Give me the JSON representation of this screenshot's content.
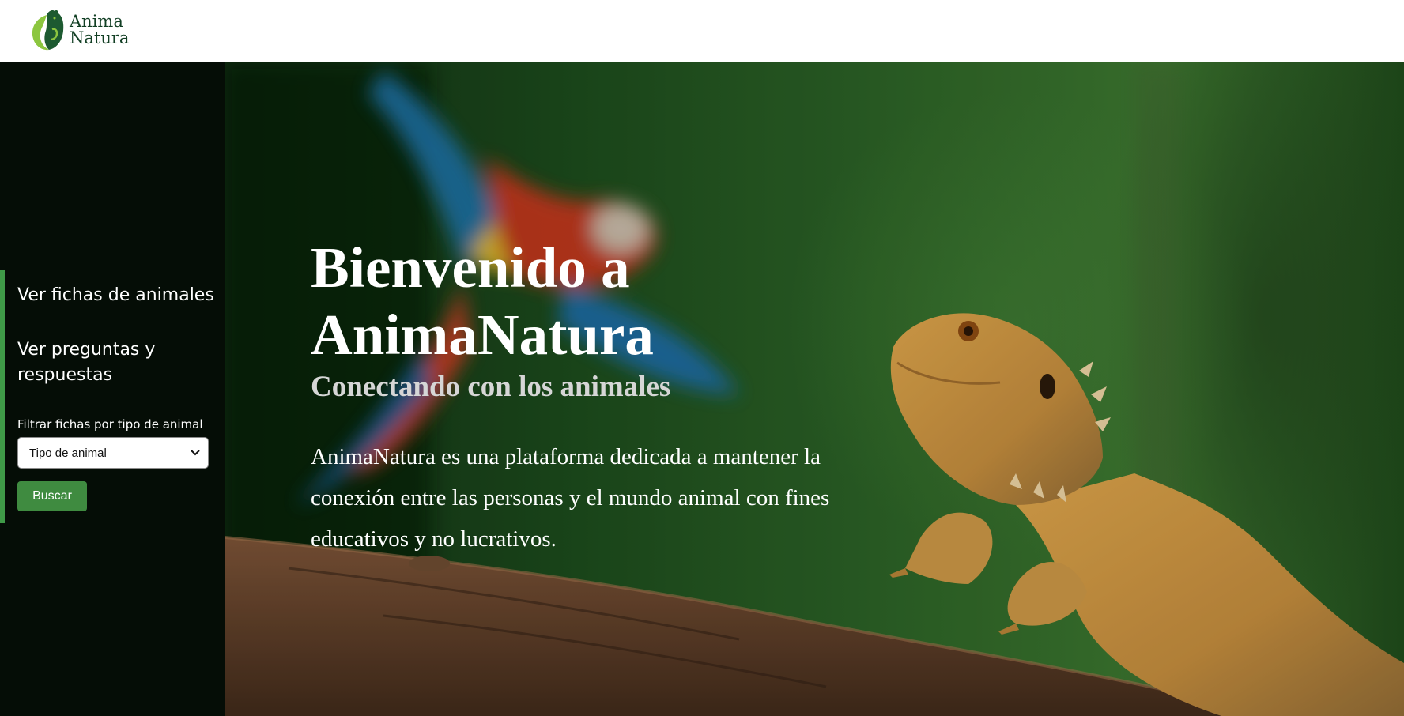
{
  "brand": {
    "line1": "Anima",
    "line2": "Natura"
  },
  "sidebar": {
    "nav": [
      {
        "label": "Ver fichas de animales"
      },
      {
        "label": "Ver preguntas y respuestas"
      }
    ],
    "filter": {
      "label": "Filtrar fichas por tipo de animal",
      "selected": "Tipo de animal",
      "button": "Buscar"
    }
  },
  "hero": {
    "title": "Bienvenido a AnimaNatura",
    "subtitle": "Conectando con los animales",
    "description": "AnimaNatura es una plataforma dedicada a mantener la conexión entre las personas y el mundo animal con fines educativos y no lucrativos."
  },
  "colors": {
    "brand": "#123f24",
    "sidebar_bg": "#050d06",
    "accent": "#3f9a47",
    "button": "#3f8b40"
  }
}
